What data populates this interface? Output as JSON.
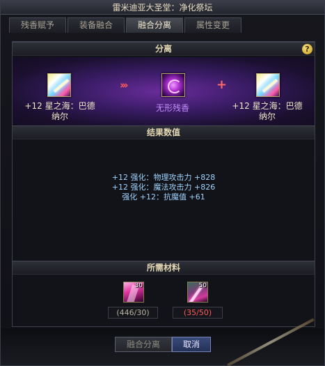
{
  "window": {
    "title": "雷米迪亚大圣堂：净化祭坛"
  },
  "tabs": [
    {
      "label": "残香赋予"
    },
    {
      "label": "装备融合"
    },
    {
      "label": "融合分离",
      "active": true
    },
    {
      "label": "属性变更"
    }
  ],
  "separation": {
    "header": "分离",
    "left_item": {
      "level": "+12",
      "name_line1": "星之海：巴德",
      "name_line2": "纳尔",
      "icon": "star-sword-icon"
    },
    "center_item": {
      "name": "无形残香",
      "icon": "purple-vortex-icon"
    },
    "right_item": {
      "level": "+12",
      "name_line1": "星之海：巴德",
      "name_line2": "纳尔",
      "icon": "star-sword-icon"
    }
  },
  "results": {
    "header": "结果数值",
    "lines": [
      "+12 强化：物理攻击力 +828",
      "+12 强化：魔法攻击力 +826",
      "强化 +12：抗魔值 +61"
    ]
  },
  "materials": {
    "header": "所需材料",
    "items": [
      {
        "icon": "pink-gem-icon",
        "badge": "30",
        "owned_text": "(446/30)",
        "sufficient": true
      },
      {
        "icon": "crystal-shard-icon",
        "badge": "50",
        "owned_text": "(35/50)",
        "sufficient": false
      }
    ]
  },
  "buttons": {
    "fuse": "融合分离",
    "cancel": "取消"
  },
  "colors": {
    "accent_text": "#e3d7b3",
    "stat_blue": "#9fd3ff",
    "insufficient_red": "#ff5a5a",
    "item_purple": "#c78cff"
  }
}
